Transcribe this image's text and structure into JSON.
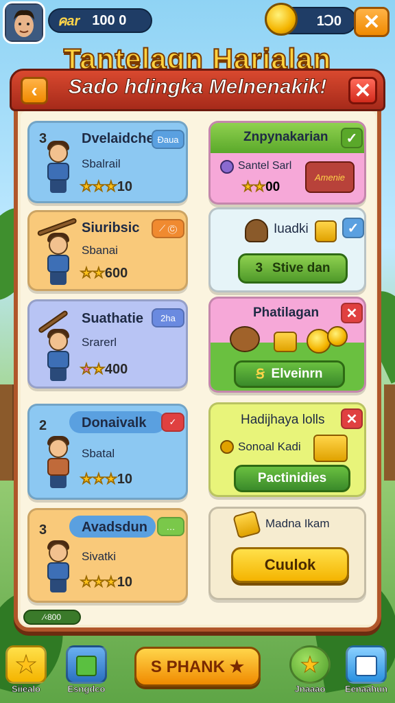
{
  "topbar": {
    "coin_label": "คar",
    "coin_value": "100 0",
    "gem_value": "1Ↄ0",
    "close_glyph": "✕"
  },
  "title": "Tantelagn Harialan",
  "subtitle": "Sado hdingka Melnenakik!",
  "panel": {
    "back_glyph": "‹",
    "close_glyph": "✕"
  },
  "left_cards": [
    {
      "num": "3",
      "name": "Dvelaidche",
      "tag": "Ɖaua",
      "sub": "Sbalrail",
      "stars": "10",
      "star_count": 3,
      "color": "#8cc8f2",
      "tag_color": "#5aa0e0"
    },
    {
      "num": "",
      "name": "Siuribsic",
      "tag": "⟋ Ⓒ",
      "sub": "Sbanai",
      "stars": "600",
      "star_count": 2,
      "color": "#f9c97a",
      "tag_color": "#f08a30"
    },
    {
      "num": "",
      "name": "Suathatie",
      "tag": "2ha",
      "sub": "Srarerl",
      "stars": "400",
      "star_count": 2,
      "color": "#b8c4f4",
      "tag_color": "#6a8ae0"
    },
    {
      "num": "2",
      "name": "Donaivalk",
      "tag": "✓",
      "sub": "Sbatal",
      "stars": "10",
      "star_count": 3,
      "color": "#8cc8f2",
      "tag_color": "#e04040"
    },
    {
      "num": "3",
      "name": "Avadsdun",
      "tag": "…",
      "sub": "Sivatki",
      "stars": "10",
      "star_count": 3,
      "color": "#f9c97a",
      "tag_color": "#7ac84a"
    }
  ],
  "right_cards": {
    "card1": {
      "title": "Znpynakarian",
      "check": "✓",
      "item": "Santel Sarl",
      "stars": "00",
      "badge": "Amenie"
    },
    "card2": {
      "item": "Iuadki",
      "check": "✓",
      "button": "Stive dan",
      "btn_num": "3"
    },
    "card3": {
      "title": "Phatilagan",
      "close": "✕",
      "button": "Elveinrn",
      "btn_num": "Ꞩ"
    },
    "card4": {
      "title": "Hadijhaya lolls",
      "close": "✕",
      "item": "Sonoal Kadi",
      "button": "Pactinidies"
    },
    "card5": {
      "item": "Madna Ikam",
      "button": "Cuulok"
    }
  },
  "progress": "⁄‹800",
  "bottom_nav": [
    {
      "label": "Siiealo",
      "color": "#f4c020"
    },
    {
      "label": "Esngdco",
      "color": "#3a8ad0"
    },
    {
      "label": "Jnaaao",
      "color": "#6ac040"
    },
    {
      "label": "Eenaahun",
      "color": "#3aa0e0"
    }
  ],
  "main_button": "S PHANK ★"
}
